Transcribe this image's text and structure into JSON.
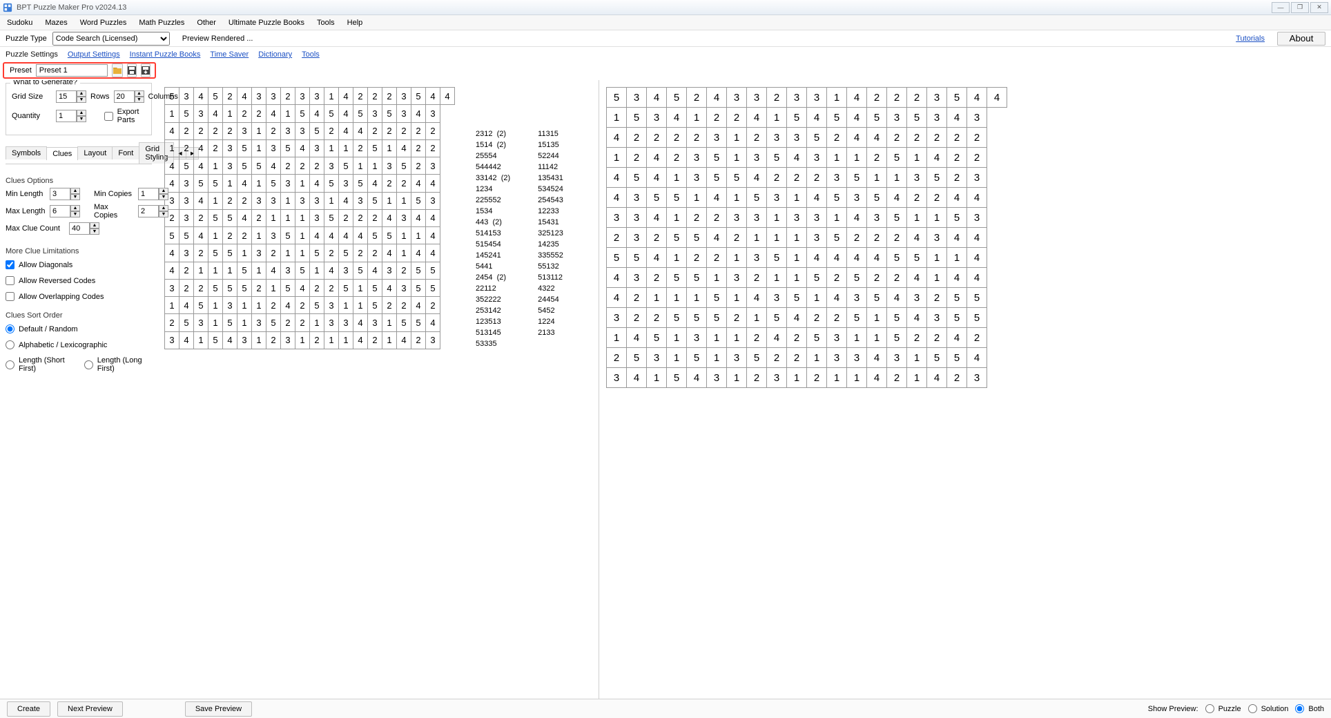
{
  "title": "BPT Puzzle Maker Pro v2024.13",
  "win_buttons": {
    "min": "—",
    "max": "❐",
    "close": "✕"
  },
  "menu": [
    "Sudoku",
    "Mazes",
    "Word Puzzles",
    "Math Puzzles",
    "Other",
    "Ultimate Puzzle Books",
    "Tools",
    "Help"
  ],
  "puzzle_type_label": "Puzzle Type",
  "puzzle_type_value": "Code Search (Licensed)",
  "preview_status": "Preview Rendered ...",
  "tutorials": "Tutorials",
  "about": "About",
  "secondary_tabs": [
    "Puzzle Settings",
    "Output Settings",
    "Instant Puzzle Books",
    "Time Saver",
    "Dictionary",
    "Tools"
  ],
  "preset_label": "Preset",
  "preset_value": "Preset 1",
  "what_to_generate": "What to Generate?",
  "grid_size_label": "Grid Size",
  "grid_rows": "15",
  "rows_label": "Rows",
  "grid_cols": "20",
  "cols_label": "Columns",
  "quantity_label": "Quantity",
  "quantity": "1",
  "export_parts": "Export Parts",
  "subtabs": [
    "Symbols",
    "Clues",
    "Layout",
    "Font",
    "Grid Styling"
  ],
  "clues_options": "Clues Options",
  "min_length_label": "Min Length",
  "min_length": "3",
  "min_copies_label": "Min Copies",
  "min_copies": "1",
  "max_length_label": "Max Length",
  "max_length": "6",
  "max_copies_label": "Max Copies",
  "max_copies": "2",
  "max_clue_count_label": "Max Clue Count",
  "max_clue_count": "40",
  "more_clue_label": "More Clue Limitations",
  "allow_diag": "Allow Diagonals",
  "allow_rev": "Allow Reversed Codes",
  "allow_ovr": "Allow Overlapping Codes",
  "sort_label": "Clues Sort Order",
  "sort_default": "Default / Random",
  "sort_alpha": "Alphabetic / Lexicographic",
  "sort_short": "Length (Short First)",
  "sort_long": "Length (Long First)",
  "grid": [
    [
      5,
      3,
      4,
      5,
      2,
      4,
      3,
      3,
      2,
      3,
      3,
      1,
      4,
      2,
      2,
      2,
      3,
      5,
      4,
      4
    ],
    [
      1,
      5,
      3,
      4,
      1,
      2,
      2,
      4,
      1,
      5,
      4,
      5,
      4,
      5,
      3,
      5,
      3,
      4,
      3
    ],
    [
      4,
      2,
      2,
      2,
      2,
      3,
      1,
      2,
      3,
      3,
      5,
      2,
      4,
      4,
      2,
      2,
      2,
      2,
      2
    ],
    [
      1,
      2,
      4,
      2,
      3,
      5,
      1,
      3,
      5,
      4,
      3,
      1,
      1,
      2,
      5,
      1,
      4,
      2,
      2
    ],
    [
      4,
      5,
      4,
      1,
      3,
      5,
      5,
      4,
      2,
      2,
      2,
      3,
      5,
      1,
      1,
      3,
      5,
      2,
      3
    ],
    [
      4,
      3,
      5,
      5,
      1,
      4,
      1,
      5,
      3,
      1,
      4,
      5,
      3,
      5,
      4,
      2,
      2,
      4,
      4
    ],
    [
      3,
      3,
      4,
      1,
      2,
      2,
      3,
      3,
      1,
      3,
      3,
      1,
      4,
      3,
      5,
      1,
      1,
      5,
      3
    ],
    [
      2,
      3,
      2,
      5,
      5,
      4,
      2,
      1,
      1,
      1,
      3,
      5,
      2,
      2,
      2,
      4,
      3,
      4,
      4
    ],
    [
      5,
      5,
      4,
      1,
      2,
      2,
      1,
      3,
      5,
      1,
      4,
      4,
      4,
      4,
      5,
      5,
      1,
      1,
      4
    ],
    [
      4,
      3,
      2,
      5,
      5,
      1,
      3,
      2,
      1,
      1,
      5,
      2,
      5,
      2,
      2,
      4,
      1,
      4,
      4
    ],
    [
      4,
      2,
      1,
      1,
      1,
      5,
      1,
      4,
      3,
      5,
      1,
      4,
      3,
      5,
      4,
      3,
      2,
      5,
      5
    ],
    [
      3,
      2,
      2,
      5,
      5,
      5,
      2,
      1,
      5,
      4,
      2,
      2,
      5,
      1,
      5,
      4,
      3,
      5,
      5
    ],
    [
      1,
      4,
      5,
      1,
      3,
      1,
      1,
      2,
      4,
      2,
      5,
      3,
      1,
      1,
      5,
      2,
      2,
      4,
      2
    ],
    [
      2,
      5,
      3,
      1,
      5,
      1,
      3,
      5,
      2,
      2,
      1,
      3,
      3,
      4,
      3,
      1,
      5,
      5,
      4
    ],
    [
      3,
      4,
      1,
      5,
      4,
      3,
      1,
      2,
      3,
      1,
      2,
      1,
      1,
      4,
      2,
      1,
      4,
      2,
      3
    ]
  ],
  "clues_left": "2312  (2)\n1514  (2)\n25554\n544442\n33142  (2)\n1234\n225552\n1534\n443  (2)\n514153\n515454\n145241\n5441\n2454  (2)\n22112\n352222\n253142\n123513\n513145\n53335",
  "clues_right": "11315\n15135\n52244\n11142\n135431\n534524\n254543\n12233\n15431\n325123\n14235\n335552\n55132\n513112\n4322\n24454\n5452\n1224\n2133",
  "btn_create": "Create",
  "btn_next": "Next Preview",
  "btn_save": "Save Preview",
  "show_preview": "Show Preview:",
  "opt_puzzle": "Puzzle",
  "opt_solution": "Solution",
  "opt_both": "Both"
}
